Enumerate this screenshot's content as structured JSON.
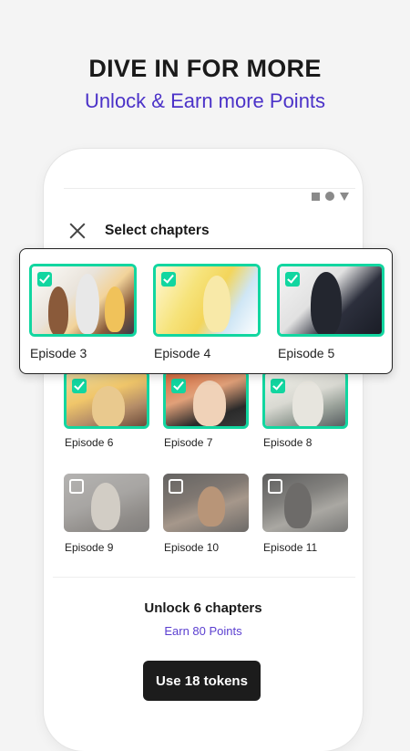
{
  "promo": {
    "headline": "DIVE IN FOR MORE",
    "subline": "Unlock & Earn more Points"
  },
  "header": {
    "title": "Select chapters",
    "close_icon": "close-icon"
  },
  "status_icons": [
    "square-icon",
    "circle-icon",
    "triangle-icon"
  ],
  "callout_episodes": [
    {
      "label": "Episode 3",
      "selected": true
    },
    {
      "label": "Episode 4",
      "selected": true
    },
    {
      "label": "Episode 5",
      "selected": true
    }
  ],
  "grid_episodes": [
    {
      "label": "Episode 6",
      "selected": true
    },
    {
      "label": "Episode 7",
      "selected": true
    },
    {
      "label": "Episode 8",
      "selected": true
    },
    {
      "label": "Episode 9",
      "selected": false
    },
    {
      "label": "Episode 10",
      "selected": false
    },
    {
      "label": "Episode 11",
      "selected": false
    }
  ],
  "summary": {
    "unlock_label": "Unlock 6 chapters",
    "earn_label": "Earn 80 Points",
    "button_label": "Use 18 tokens"
  },
  "colors": {
    "accent_check": "#12d6a0",
    "link_purple": "#5b3fd0",
    "subline_purple": "#4b32c8",
    "button_bg": "#1c1c1c"
  }
}
